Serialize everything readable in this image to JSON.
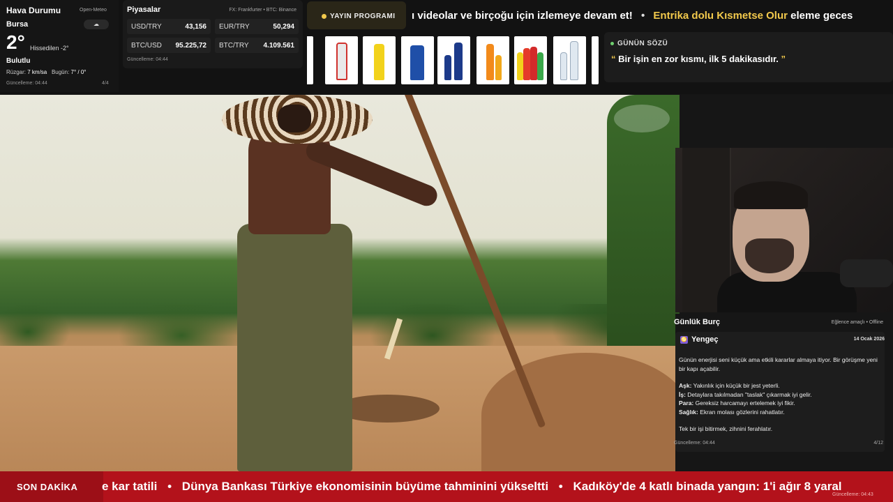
{
  "weather": {
    "title": "Hava Durumu",
    "source": "Open-Meteo",
    "city": "Bursa",
    "condition_icon": "cloud-icon",
    "temperature": "2°",
    "feels_like": "Hissedilen -2°",
    "description": "Bulutlu",
    "wind_label": "Rüzgar:",
    "wind_value": "7 km/sa",
    "today_label": "Bugün:",
    "today_value": "7° / 0°",
    "updated": "Güncelleme: 04:44",
    "page": "4/4"
  },
  "markets": {
    "title": "Piyasalar",
    "source": "FX: Frankfurter • BTC: Binance",
    "items": [
      {
        "label": "USD/TRY",
        "value": "43,156"
      },
      {
        "label": "EUR/TRY",
        "value": "50,294"
      },
      {
        "label": "BTC/USD",
        "value": "95.225,72"
      },
      {
        "label": "BTC/TRY",
        "value": "4.109.561"
      }
    ],
    "updated": "Güncelleme: 04:44"
  },
  "schedule": {
    "label": "YAYIN PROGRAMI",
    "text_before": "ı videolar ve birçoğu için izlemeye devam et!",
    "separator": "•",
    "highlight": "Entrika dolu Kısmetse Olur",
    "text_after": "eleme geces"
  },
  "products": {
    "colors": [
      "#e8f2e0",
      "#d0312d",
      "#f2d21b",
      "#1f4fa8",
      "#1c3a8a",
      "#f28a1b",
      "#e53b2a",
      "#dfe8f0"
    ]
  },
  "quote": {
    "title": "GÜNÜN SÖZÜ",
    "open_mark": "“",
    "text": "Bir işin en zor kısmı, ilk 5 dakikasıdır.",
    "close_mark": "”"
  },
  "horoscope": {
    "title": "Günlük Burç",
    "tag": "Eğlence amaçlı • Offline",
    "sign": "Yengeç",
    "sign_icon": "♋",
    "date": "14 Ocak 2026",
    "intro": "Günün enerjisi seni küçük ama etkili kararlar almaya itiyor. Bir görüşme yeni bir kapı açabilir.",
    "love_label": "Aşk:",
    "love": "Yakınlık için küçük bir jest yeterli.",
    "work_label": "İş:",
    "work": "Detaylara takılmadan \"taslak\" çıkarmak iyi gelir.",
    "money_label": "Para:",
    "money": "Gereksiz harcamayı ertelemek iyi fikir.",
    "health_label": "Sağlık:",
    "health": "Ekran molası gözlerini rahatlatır.",
    "closing": "Tek bir işi bitirmek, zihnini ferahlatır.",
    "updated": "Güncelleme: 04:44",
    "page": "4/12"
  },
  "news": {
    "label": "SON DAKİKA",
    "items": [
      "e kar tatili",
      "Dünya Bankası Türkiye ekonomisinin büyüme tahminini yükseltti",
      "Kadıköy'de 4 katlı binada yangın: 1'i ağır 8 yaral"
    ],
    "separator": "•",
    "updated": "Güncelleme: 04:43"
  }
}
